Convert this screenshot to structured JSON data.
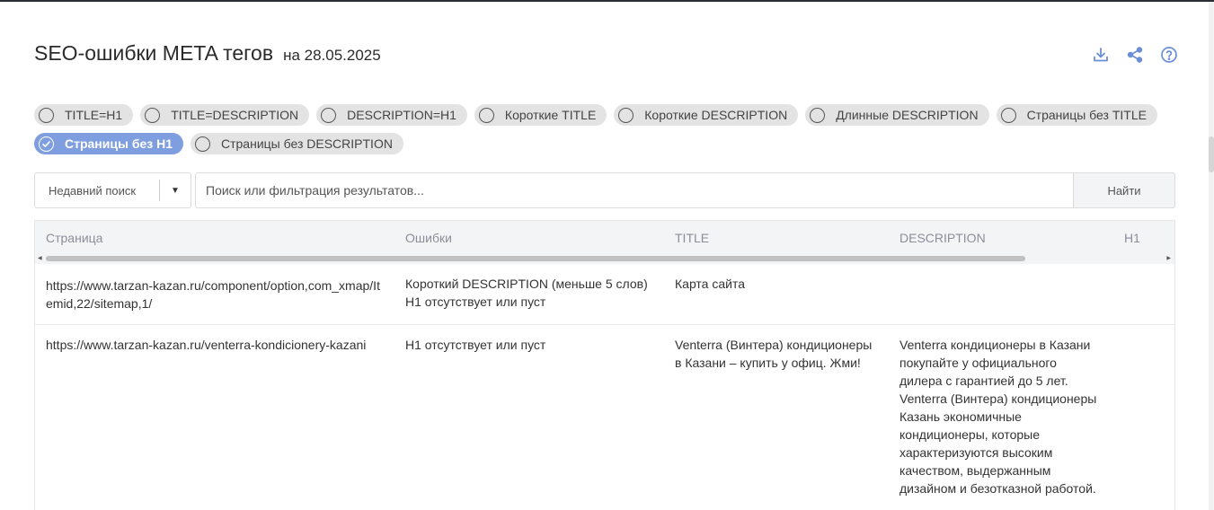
{
  "header": {
    "title": "SEO-ошибки META тегов",
    "date": "на 28.05.2025"
  },
  "icons": {
    "download": "download-icon",
    "share": "share-icon",
    "help": "help-icon"
  },
  "colors": {
    "active_chip": "#7e9ee0",
    "accent_icon": "#6b8fd6"
  },
  "filters": [
    {
      "label": "TITLE=H1",
      "active": false
    },
    {
      "label": "TITLE=DESCRIPTION",
      "active": false
    },
    {
      "label": "DESCRIPTION=H1",
      "active": false
    },
    {
      "label": "Короткие TITLE",
      "active": false
    },
    {
      "label": "Короткие DESCRIPTION",
      "active": false
    },
    {
      "label": "Длинные DESCRIPTION",
      "active": false
    },
    {
      "label": "Страницы без TITLE",
      "active": false
    },
    {
      "label": "Страницы без H1",
      "active": true
    },
    {
      "label": "Страницы без DESCRIPTION",
      "active": false
    }
  ],
  "search": {
    "recent_label": "Недавний поиск",
    "placeholder": "Поиск или фильтрация результатов...",
    "value": "",
    "button_label": "Найти"
  },
  "table": {
    "columns": [
      "Страница",
      "Ошибки",
      "TITLE",
      "DESCRIPTION",
      "H1"
    ],
    "rows": [
      {
        "page": [
          "https://www.tarzan-kazan.ru/component/option,com_xmap/It",
          "emid,22/sitemap,1/"
        ],
        "errors": [
          "Короткий DESCRIPTION (меньше 5 слов)",
          "H1 отсутствует или пуст"
        ],
        "title": [
          "Карта сайта"
        ],
        "description": [],
        "h1": ""
      },
      {
        "page": [
          "https://www.tarzan-kazan.ru/venterra-kondicionery-kazani"
        ],
        "errors": [
          "H1 отсутствует или пуст"
        ],
        "title": [
          "Venterra (Винтера) кондиционеры",
          "в Казани – купить у офиц. Жми!"
        ],
        "description": [
          "Venterra кондиционеры в Казани",
          "покупайте у официального",
          "дилера с гарантией до 5 лет.",
          "Venterra (Винтера) кондиционеры",
          "Казань экономичные",
          "кондиционеры, которые",
          "характеризуются высоким",
          "качеством, выдержанным",
          "дизайном и безотказной работой."
        ],
        "h1": ""
      }
    ]
  }
}
